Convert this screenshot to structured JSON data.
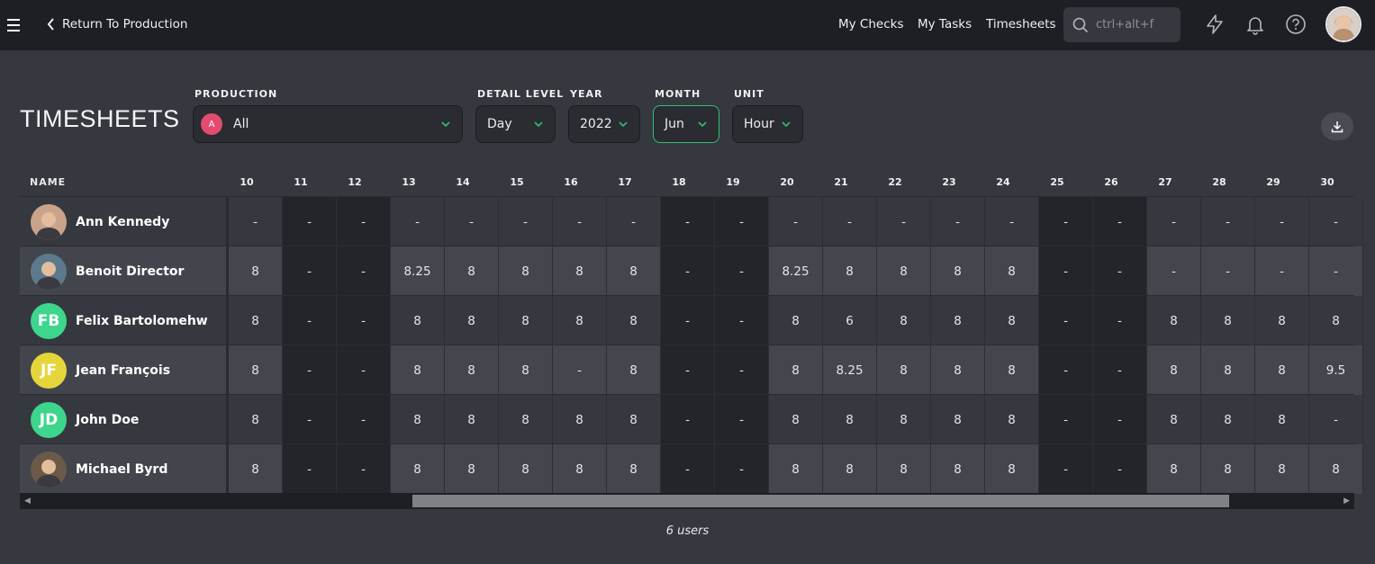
{
  "topbar": {
    "back_label": "Return To Production",
    "nav": [
      "My Checks",
      "My Tasks",
      "Timesheets"
    ],
    "search_placeholder": "ctrl+alt+f"
  },
  "page": {
    "title": "TIMESHEETS",
    "filters": {
      "production_label": "PRODUCTION",
      "production_value": "All",
      "production_initial": "A",
      "detail_label": "DETAIL LEVEL",
      "detail_value": "Day",
      "year_label": "YEAR",
      "year_value": "2022",
      "month_label": "MONTH",
      "month_value": "Jun",
      "unit_label": "UNIT",
      "unit_value": "Hour"
    }
  },
  "table": {
    "name_header": "NAME",
    "days": [
      "10",
      "11",
      "12",
      "13",
      "14",
      "15",
      "16",
      "17",
      "18",
      "19",
      "20",
      "21",
      "22",
      "23",
      "24",
      "25",
      "26",
      "27",
      "28",
      "29",
      "30"
    ],
    "weekend_days": [
      "11",
      "12",
      "18",
      "19",
      "25",
      "26"
    ],
    "rows": [
      {
        "name": "Ann Kennedy",
        "avatar": "photo",
        "initials": "",
        "color": "#c9a48a",
        "values": [
          "-",
          "-",
          "-",
          "-",
          "-",
          "-",
          "-",
          "-",
          "-",
          "-",
          "-",
          "-",
          "-",
          "-",
          "-",
          "-",
          "-",
          "-",
          "-",
          "-",
          "-"
        ]
      },
      {
        "name": "Benoit Director",
        "avatar": "photo",
        "initials": "",
        "color": "#5d7a8c",
        "values": [
          "8",
          "-",
          "-",
          "8.25",
          "8",
          "8",
          "8",
          "8",
          "-",
          "-",
          "8.25",
          "8",
          "8",
          "8",
          "8",
          "-",
          "-",
          "-",
          "-",
          "-",
          "-"
        ]
      },
      {
        "name": "Felix Bartolomehw",
        "avatar": "initials",
        "initials": "FB",
        "color": "#3dd68c",
        "values": [
          "8",
          "-",
          "-",
          "8",
          "8",
          "8",
          "8",
          "8",
          "-",
          "-",
          "8",
          "6",
          "8",
          "8",
          "8",
          "-",
          "-",
          "8",
          "8",
          "8",
          "8"
        ]
      },
      {
        "name": "Jean François",
        "avatar": "initials",
        "initials": "JF",
        "color": "#e6d53a",
        "values": [
          "8",
          "-",
          "-",
          "8",
          "8",
          "8",
          "-",
          "8",
          "-",
          "-",
          "8",
          "8.25",
          "8",
          "8",
          "8",
          "-",
          "-",
          "8",
          "8",
          "8",
          "9.5"
        ]
      },
      {
        "name": "John Doe",
        "avatar": "initials",
        "initials": "JD",
        "color": "#3dd68c",
        "values": [
          "8",
          "-",
          "-",
          "8",
          "8",
          "8",
          "8",
          "8",
          "-",
          "-",
          "8",
          "8",
          "8",
          "8",
          "8",
          "-",
          "-",
          "8",
          "8",
          "8",
          "-"
        ]
      },
      {
        "name": "Michael Byrd",
        "avatar": "photo",
        "initials": "",
        "color": "#6b5a47",
        "values": [
          "8",
          "-",
          "-",
          "8",
          "8",
          "8",
          "8",
          "8",
          "-",
          "-",
          "8",
          "8",
          "8",
          "8",
          "8",
          "-",
          "-",
          "8",
          "8",
          "8",
          "8"
        ]
      }
    ]
  },
  "footer": {
    "count_label": "6 users"
  },
  "colors": {
    "accent": "#2fbf71",
    "background": "#36383f",
    "topbar": "#1e1f24"
  },
  "icons": [
    "menu-icon",
    "chevron-left-icon",
    "search-icon",
    "lightning-icon",
    "bell-icon",
    "help-icon",
    "download-icon",
    "chevron-down-icon"
  ]
}
